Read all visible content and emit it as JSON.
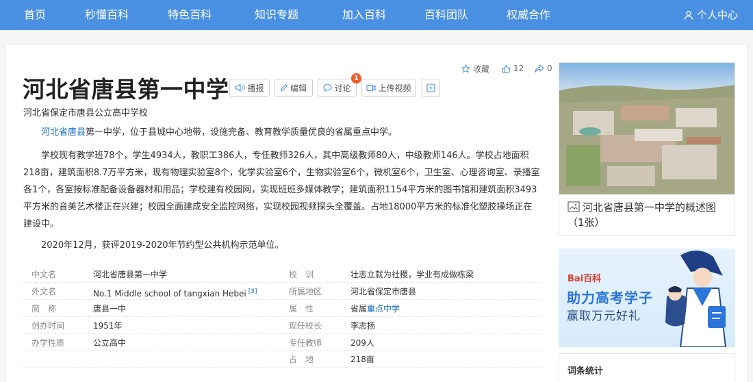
{
  "nav": {
    "items": [
      "首页",
      "秒懂百科",
      "特色百科",
      "知识专题",
      "加入百科",
      "百科团队",
      "权威合作"
    ],
    "user_center": "个人中心"
  },
  "entry": {
    "title": "河北省唐县第一中学",
    "subtitle": "河北省保定市唐县公立高中学校",
    "buttons": {
      "broadcast": "播报",
      "edit": "编辑",
      "discuss": "讨论",
      "discuss_badge": "1",
      "upload_video": "上传视频"
    },
    "actions": {
      "favorite": "收藏",
      "like_count": "12",
      "share_count": "0"
    }
  },
  "body": {
    "p1_link": "河北省唐县",
    "p1_rest": "第一中学，位于县城中心地带，设施完备、教育教学质量优良的省属重点中学。",
    "p2": "学校现有教学班78个，学生4934人，教职工386人，专任教师326人，其中高级教师80人，中级教师146人。学校占地面积218亩，建筑面积8.7万平方米，现有物理实验室8个，化学实验室6个，生物实验室6个，微机室6个，卫生室、心理咨询室、录播室各1个，各室按标准配备设备器材和用品；学校建有校园网，实现班班多媒体教学；建筑面积1154平方米的图书馆和建筑面积3493平方米的音美艺术楼正在兴建；校园全面建成安全监控网络，实现校园视频探头全覆盖。占地18000平方米的标准化塑胶操场正在建设中。",
    "p3": "2020年12月，获评2019-2020年节约型公共机构示范单位。"
  },
  "basic_info": {
    "left": [
      {
        "label": "中文名",
        "value": "河北省唐县第一中学"
      },
      {
        "label": "外文名",
        "value": "No.1 Middle school of tangxian Hebei",
        "ref": "[3]"
      },
      {
        "label": "简　称",
        "value": "唐县一中"
      },
      {
        "label": "创办时间",
        "value": "1951年"
      },
      {
        "label": "办学性质",
        "value": "公立高中"
      }
    ],
    "right": [
      {
        "label": "校　训",
        "value": "壮志立就为社稷，学业有成做栋梁"
      },
      {
        "label": "所属地区",
        "value": "河北省保定市唐县"
      },
      {
        "label": "属　性",
        "value_prefix": "省属",
        "value_link": "重点中学"
      },
      {
        "label": "现任校长",
        "value_link": "李志扬"
      },
      {
        "label": "专任教师",
        "value": "209人"
      },
      {
        "label": "占　地",
        "value": "218亩"
      }
    ]
  },
  "sidebar": {
    "album_caption": "河北省唐县第一中学的概述图（1张）",
    "ad": {
      "logo_text": "Bai百科",
      "line1": "助力高考学子",
      "line2": "赢取万元好礼"
    },
    "stats_title": "词条统计"
  },
  "colors": {
    "nav_bg": "#4a90e2",
    "link": "#136ec2",
    "badge": "#f25a29"
  }
}
